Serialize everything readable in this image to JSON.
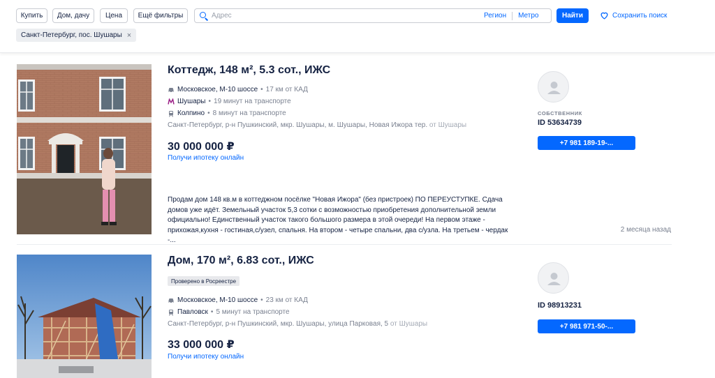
{
  "filters": {
    "buy": "Купить",
    "type": "Дом, дачу",
    "price": "Цена",
    "more": "Ещё фильтры",
    "search_placeholder": "Адрес",
    "region": "Регион",
    "metro": "Метро",
    "find": "Найти",
    "save_search": "Сохранить поиск",
    "active_tag": "Санкт-Петербург, пос. Шушары",
    "tag_close": "×"
  },
  "listings": [
    {
      "title": "Коттедж, 148 м², 5.3 сот., ИЖС",
      "transport": [
        {
          "icon": "car-icon",
          "name": "Московское, М-10 шоссе",
          "detail": "17 км от КАД"
        },
        {
          "icon": "metro-icon",
          "name": "Шушары",
          "detail": "19 минут на транспорте"
        },
        {
          "icon": "train-icon",
          "name": "Колпино",
          "detail": "8 минут на транспорте"
        }
      ],
      "address": "Санкт-Петербург, р-н Пушкинский, мкр. Шушары, м. Шушары, Новая Ижора тер.",
      "address_suffix": "от Шушары",
      "price": "30 000 000 ₽",
      "mortgage": "Получи ипотеку онлайн",
      "description": "Продам дом 148 кв.м в коттеджном посёлке \"Новая Ижора\" (без пристроек) ПО ПЕРЕУСТУПКЕ. Сдача домов уже идёт. Земельный участок 5,3 сотки с возможностью приобретения дополнительной земли официально! Единственный участок такого большого размера в этой очереди! На первом этаже - прихожая,кухня - гостиная,с/узел, спальня. На втором - четыре спальни, два с/узла. На третьем - чердак -...",
      "date": "2 месяца назад",
      "agent_role": "СОБСТВЕННИК",
      "agent_id": "ID 53634739",
      "phone": "+7 981 189-19-..."
    },
    {
      "title": "Дом, 170 м², 6.83 сот., ИЖС",
      "badge": "Проверено в Росреестре",
      "transport": [
        {
          "icon": "car-icon",
          "name": "Московское, М-10 шоссе",
          "detail": "23 км от КАД"
        },
        {
          "icon": "train-icon",
          "name": "Павловск",
          "detail": "5 минут на транспорте"
        }
      ],
      "address": "Санкт-Петербург, р-н Пушкинский, мкр. Шушары, улица Парковая, 5",
      "address_suffix": "от Шушары",
      "price": "33 000 000 ₽",
      "mortgage": "Получи ипотеку онлайн",
      "agent_id": "ID 98913231",
      "phone": "+7 981 971-50-..."
    }
  ],
  "colors": {
    "accent": "#0468ff",
    "text": "#152242",
    "muted": "#7a8190",
    "metro": "#9b1f86"
  }
}
